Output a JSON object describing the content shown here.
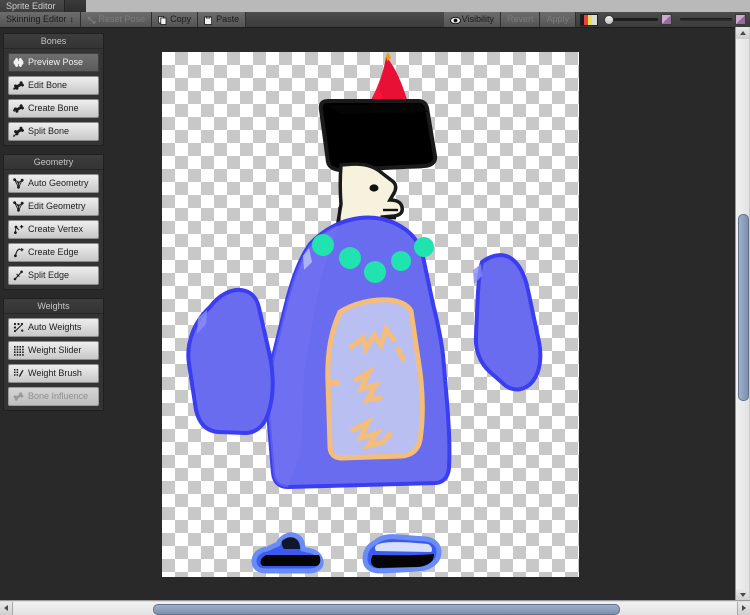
{
  "window": {
    "title": "Sprite Editor"
  },
  "toolbar": {
    "mode_dropdown": {
      "label": "Skinning Editor",
      "icon": "updown-arrows-icon",
      "glyph": "↕"
    },
    "reset_pose": {
      "label": "Reset Pose",
      "icon": "reset-pose-icon",
      "enabled": false
    },
    "copy": {
      "label": "Copy",
      "icon": "copy-icon",
      "enabled": true
    },
    "paste": {
      "label": "Paste",
      "icon": "paste-icon",
      "enabled": true
    },
    "visibility": {
      "label": "Visibility",
      "icon": "eye-icon",
      "enabled": true
    },
    "revert": {
      "label": "Revert",
      "enabled": false
    },
    "apply": {
      "label": "Apply",
      "enabled": false
    },
    "color_swatch": {
      "icon": "color-palette-icon"
    },
    "opacity_slider": {
      "icon": "opacity-slider",
      "value": 0
    },
    "size_slider": {
      "icon": "size-slider",
      "value": 100
    }
  },
  "panels": [
    {
      "title": "Bones",
      "name": "bones",
      "items": [
        {
          "label": "Preview Pose",
          "icon": "bone-preview-icon",
          "state": "active"
        },
        {
          "label": "Edit Bone",
          "icon": "bone-edit-icon",
          "state": "normal"
        },
        {
          "label": "Create Bone",
          "icon": "bone-create-icon",
          "state": "normal"
        },
        {
          "label": "Split Bone",
          "icon": "bone-split-icon",
          "state": "normal"
        }
      ]
    },
    {
      "title": "Geometry",
      "name": "geometry",
      "items": [
        {
          "label": "Auto Geometry",
          "icon": "auto-geometry-icon",
          "state": "normal"
        },
        {
          "label": "Edit Geometry",
          "icon": "edit-geometry-icon",
          "state": "normal"
        },
        {
          "label": "Create Vertex",
          "icon": "create-vertex-icon",
          "state": "normal"
        },
        {
          "label": "Create Edge",
          "icon": "create-edge-icon",
          "state": "normal"
        },
        {
          "label": "Split Edge",
          "icon": "split-edge-icon",
          "state": "normal"
        }
      ]
    },
    {
      "title": "Weights",
      "name": "weights",
      "items": [
        {
          "label": "Auto Weights",
          "icon": "auto-weights-icon",
          "state": "normal"
        },
        {
          "label": "Weight Slider",
          "icon": "weight-slider-icon",
          "state": "normal"
        },
        {
          "label": "Weight Brush",
          "icon": "weight-brush-icon",
          "state": "normal"
        },
        {
          "label": "Bone Influence",
          "icon": "bone-influence-icon",
          "state": "disabled"
        }
      ]
    }
  ],
  "canvas": {
    "name": "sprite-canvas",
    "background": "checkerboard-transparency",
    "sprite": {
      "name": "character-sprite",
      "parts": [
        {
          "name": "hat-cone",
          "color": "#f5153c"
        },
        {
          "name": "hat-brim",
          "color": "#000000"
        },
        {
          "name": "head-face",
          "color": "#f7f2dd"
        },
        {
          "name": "body-robe",
          "color": "#6a6cf0"
        },
        {
          "name": "robe-inner-panel",
          "color": "#b9bff0"
        },
        {
          "name": "collar-beads",
          "color": "#21e3b0"
        },
        {
          "name": "squiggle-detail",
          "color": "#f5bd7a"
        },
        {
          "name": "left-sleeve",
          "color": "#6a6cf0"
        },
        {
          "name": "right-sleeve",
          "color": "#6a6cf0"
        },
        {
          "name": "shoe-left",
          "color": "#000000"
        },
        {
          "name": "shoe-right",
          "color": "#000000"
        }
      ]
    }
  },
  "scrollbars": {
    "horizontal": {
      "name": "horizontal-scrollbar"
    },
    "vertical": {
      "name": "vertical-scrollbar"
    }
  }
}
